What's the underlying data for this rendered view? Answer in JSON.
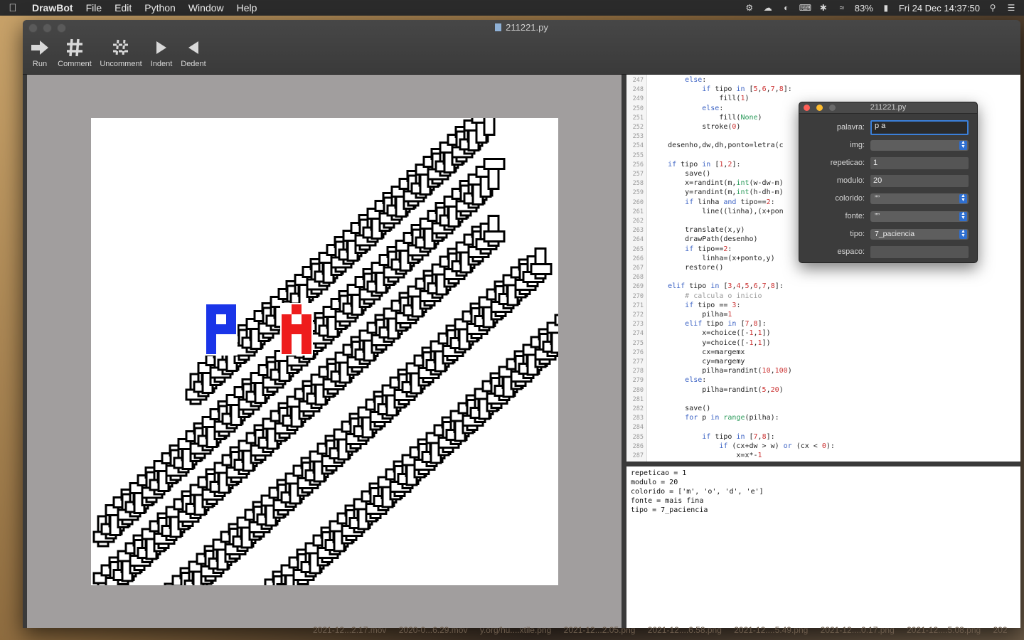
{
  "menubar": {
    "app": "DrawBot",
    "items": [
      "File",
      "Edit",
      "Python",
      "Window",
      "Help"
    ],
    "battery": "83%",
    "clock": "Fri 24 Dec  14:37:50"
  },
  "window": {
    "title": "211221.py",
    "toolbar": [
      {
        "label": "Run",
        "icon": "run-icon"
      },
      {
        "label": "Comment",
        "icon": "comment-icon"
      },
      {
        "label": "Uncomment",
        "icon": "uncomment-icon"
      },
      {
        "label": "Indent",
        "icon": "indent-icon"
      },
      {
        "label": "Dedent",
        "icon": "dedent-icon"
      }
    ]
  },
  "artwork": {
    "letters": [
      {
        "char": "P",
        "color": "#1a35e8"
      },
      {
        "char": "A",
        "color": "#ee1c1c"
      }
    ]
  },
  "editor": {
    "first_line": 247,
    "lines": [
      "        else:",
      "            if tipo in [5,6,7,8]:",
      "                fill(1)",
      "            else:",
      "                fill(None)",
      "            stroke(0)",
      "",
      "    desenho,dw,dh,ponto=letra(c",
      "",
      "    if tipo in [1,2]:",
      "        save()",
      "        x=randint(m,int(w-dw-m)",
      "        y=randint(m,int(h-dh-m)",
      "        if linha and tipo==2:",
      "            line((linha),(x+pon",
      "",
      "        translate(x,y)",
      "        drawPath(desenho)",
      "        if tipo==2:",
      "            linha=(x+ponto,y)",
      "        restore()",
      "",
      "    elif tipo in [3,4,5,6,7,8]:",
      "        # calcula o inicio",
      "        if tipo == 3:",
      "            pilha=1",
      "        elif tipo in [7,8]:",
      "            x=choice([-1,1])",
      "            y=choice([-1,1])",
      "            cx=margemx",
      "            cy=margemy",
      "            pilha=randint(10,100)",
      "        else:",
      "            pilha=randint(5,20)",
      "",
      "        save()",
      "        for p in range(pilha):",
      "",
      "            if tipo in [7,8]:",
      "                if (cx+dw > w) or (cx < 0):",
      "                    x=x*-1"
    ]
  },
  "output": [
    "repeticao = 1",
    "modulo = 20",
    "colorido = ['m', 'o', 'd', 'e']",
    "fonte = mais fina",
    "tipo = 7_paciencia"
  ],
  "panel": {
    "title": "211221.py",
    "fields": [
      {
        "label": "palavra:",
        "value": "p a",
        "kind": "text-active"
      },
      {
        "label": "img:",
        "value": "",
        "kind": "popup"
      },
      {
        "label": "repeticao:",
        "value": "1",
        "kind": "text"
      },
      {
        "label": "modulo:",
        "value": "20",
        "kind": "text"
      },
      {
        "label": "colorido:",
        "value": "””",
        "kind": "popup"
      },
      {
        "label": "fonte:",
        "value": "””",
        "kind": "popup"
      },
      {
        "label": "tipo:",
        "value": "7_paciencia",
        "kind": "popup"
      },
      {
        "label": "espaco:",
        "value": "",
        "kind": "text"
      }
    ]
  },
  "desktop_files": [
    "2021-12...2.17.mov",
    "2020-0...6.29.mov",
    "y.org/hu....xtile.png",
    "2021-12...2.05.png",
    "2021-12....6.58.png",
    "2021-12....5.49.png",
    "2021-12....0.17.png",
    "2021-12....5.08.png",
    "202"
  ]
}
